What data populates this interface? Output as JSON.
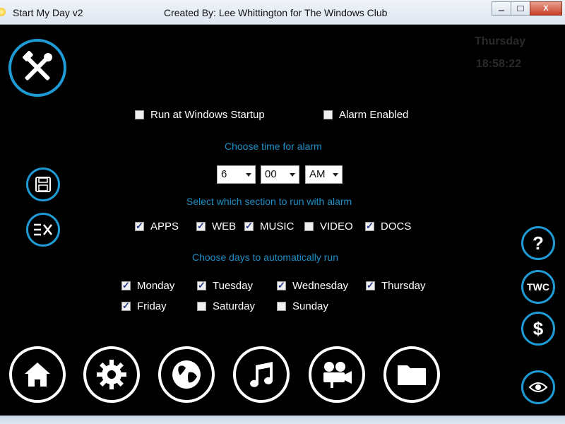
{
  "window": {
    "title": "Start My Day v2",
    "credit": "Created By: Lee Whittington for The Windows Club",
    "controls": {
      "minimize": "–",
      "maximize": "□",
      "close": "X"
    }
  },
  "clock": {
    "day": "Thursday",
    "time": "18:58:22"
  },
  "settings": {
    "run_at_startup": {
      "label": "Run at Windows Startup",
      "checked": false
    },
    "alarm_enabled": {
      "label": "Alarm Enabled",
      "checked": false
    }
  },
  "alarm": {
    "heading": "Choose time for alarm",
    "hour": "6",
    "minute": "00",
    "ampm": "AM"
  },
  "sections": {
    "heading": "Select which section to run with alarm",
    "items": [
      {
        "label": "APPS",
        "checked": true
      },
      {
        "label": "WEB",
        "checked": true
      },
      {
        "label": "MUSIC",
        "checked": true
      },
      {
        "label": "VIDEO",
        "checked": false
      },
      {
        "label": "DOCS",
        "checked": true
      }
    ]
  },
  "days": {
    "heading": "Choose days to automatically run",
    "items": [
      {
        "label": "Monday",
        "checked": true
      },
      {
        "label": "Tuesday",
        "checked": true
      },
      {
        "label": "Wednesday",
        "checked": true
      },
      {
        "label": "Thursday",
        "checked": true
      },
      {
        "label": "Friday",
        "checked": true
      },
      {
        "label": "Saturday",
        "checked": false
      },
      {
        "label": "Sunday",
        "checked": false
      }
    ]
  },
  "side_buttons": {
    "help": "?",
    "twc": "TWC",
    "donate": "$"
  },
  "icons": [
    "tools-icon",
    "save-icon",
    "exit-icon",
    "help-icon",
    "twc-icon",
    "dollar-icon",
    "eye-icon",
    "home-icon",
    "gear-icon",
    "globe-icon",
    "music-icon",
    "video-camera-icon",
    "folder-icon"
  ],
  "colors": {
    "accent": "#1e9bd4",
    "label_blue": "#1e8fc6",
    "background": "#000000"
  }
}
